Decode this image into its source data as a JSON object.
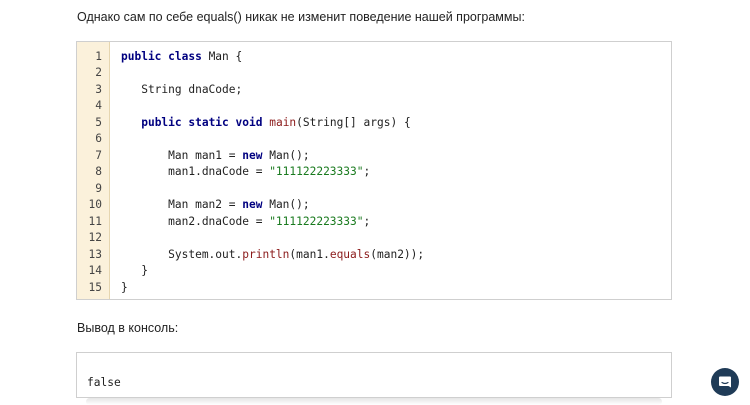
{
  "intro_text": "Однако сам по себе equals() никак не изменит поведение нашей программы:",
  "console_label": "Вывод в консоль:",
  "code": {
    "line_numbers": [
      "1",
      "2",
      "3",
      "4",
      "5",
      "6",
      "7",
      "8",
      "9",
      "10",
      "11",
      "12",
      "13",
      "14",
      "15"
    ],
    "lines": [
      [
        {
          "t": "public class",
          "c": "kw"
        },
        {
          "t": " Man {",
          "c": ""
        }
      ],
      [],
      [
        {
          "t": "   String dnaCode;",
          "c": ""
        }
      ],
      [],
      [
        {
          "t": "   ",
          "c": ""
        },
        {
          "t": "public static void",
          "c": "kw"
        },
        {
          "t": " ",
          "c": ""
        },
        {
          "t": "main",
          "c": "fn"
        },
        {
          "t": "(String[] args) {",
          "c": ""
        }
      ],
      [],
      [
        {
          "t": "       Man man1 = ",
          "c": ""
        },
        {
          "t": "new",
          "c": "kw"
        },
        {
          "t": " Man();",
          "c": ""
        }
      ],
      [
        {
          "t": "       man1.dnaCode = ",
          "c": ""
        },
        {
          "t": "\"111122223333\"",
          "c": "str"
        },
        {
          "t": ";",
          "c": ""
        }
      ],
      [],
      [
        {
          "t": "       Man man2 = ",
          "c": ""
        },
        {
          "t": "new",
          "c": "kw"
        },
        {
          "t": " Man();",
          "c": ""
        }
      ],
      [
        {
          "t": "       man2.dnaCode = ",
          "c": ""
        },
        {
          "t": "\"111122223333\"",
          "c": "str"
        },
        {
          "t": ";",
          "c": ""
        }
      ],
      [],
      [
        {
          "t": "       System.out.",
          "c": ""
        },
        {
          "t": "println",
          "c": "fn"
        },
        {
          "t": "(man1.",
          "c": ""
        },
        {
          "t": "equals",
          "c": "fn"
        },
        {
          "t": "(man2));",
          "c": ""
        }
      ],
      [
        {
          "t": "   }",
          "c": ""
        }
      ],
      [
        {
          "t": "}",
          "c": ""
        }
      ]
    ]
  },
  "console_output": "false",
  "chat_icon": "chat-icon"
}
